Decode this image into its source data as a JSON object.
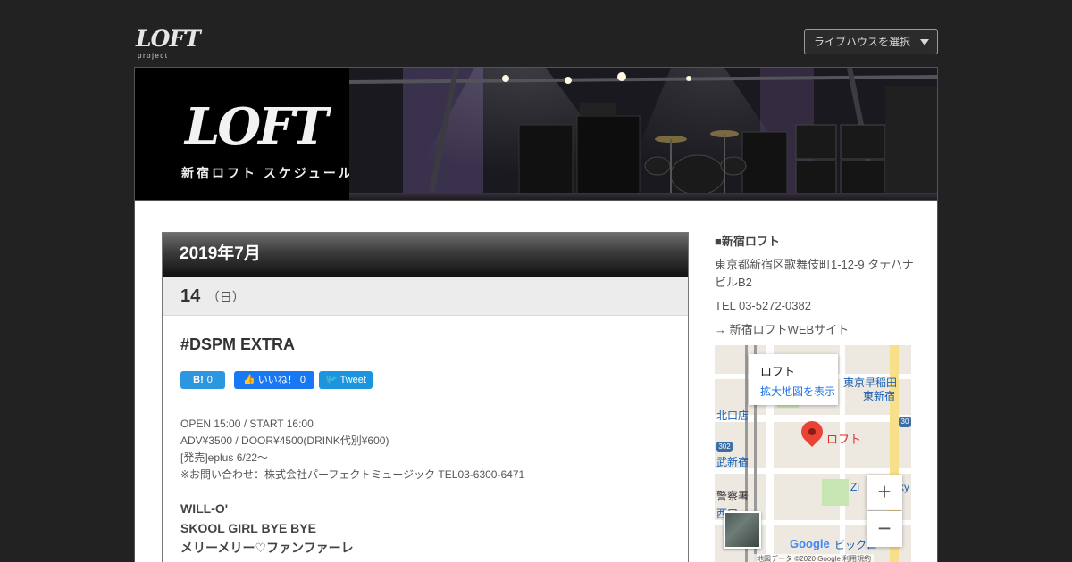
{
  "header": {
    "logo_mark": "LOFT",
    "logo_sub": "project",
    "venue_select": "ライブハウスを選択"
  },
  "banner": {
    "logo": "LOFT",
    "title": "新宿ロフト スケジュール"
  },
  "schedule": {
    "month": "2019年7月",
    "day": "14",
    "weekday": "（日）",
    "event_title": "#DSPM EXTRA",
    "share": {
      "hatena_label": "B!",
      "hatena_count": "0",
      "like_label": "いいね！",
      "like_count": "0",
      "tweet_label": "Tweet"
    },
    "info": [
      "OPEN 15:00 / START 16:00",
      "ADV¥3500 / DOOR¥4500(DRINK代別¥600)",
      "[発売]eplus 6/22〜",
      "※お問い合わせ：株式会社パーフェクトミュージック TEL03-6300-6471"
    ],
    "lineup": [
      "WILL-O'",
      "SKOOL GIRL BYE BYE",
      "メリーメリー♡ファンファーレ"
    ]
  },
  "sidebar": {
    "heading": "■新宿ロフト",
    "address": "東京都新宿区歌舞伎町1-12-9 タテハナビルB2",
    "tel": "TEL 03-5272-0382",
    "link": "→ 新宿ロフトWEBサイト"
  },
  "map": {
    "info_name": "ロフト",
    "info_link": "拡大地図を表示",
    "pin_label": "ロフト",
    "labels": [
      "東京早稲田",
      "東新宿",
      "北口店",
      "武新宿",
      "警察署",
      "西口",
      "Zi",
      "ky",
      "ビックロ"
    ],
    "route_302": "302",
    "route_30": "30",
    "google": "Google",
    "copyright": "地図データ ©2020 Google 利用規約",
    "zoom_in": "+",
    "zoom_out": "−"
  }
}
